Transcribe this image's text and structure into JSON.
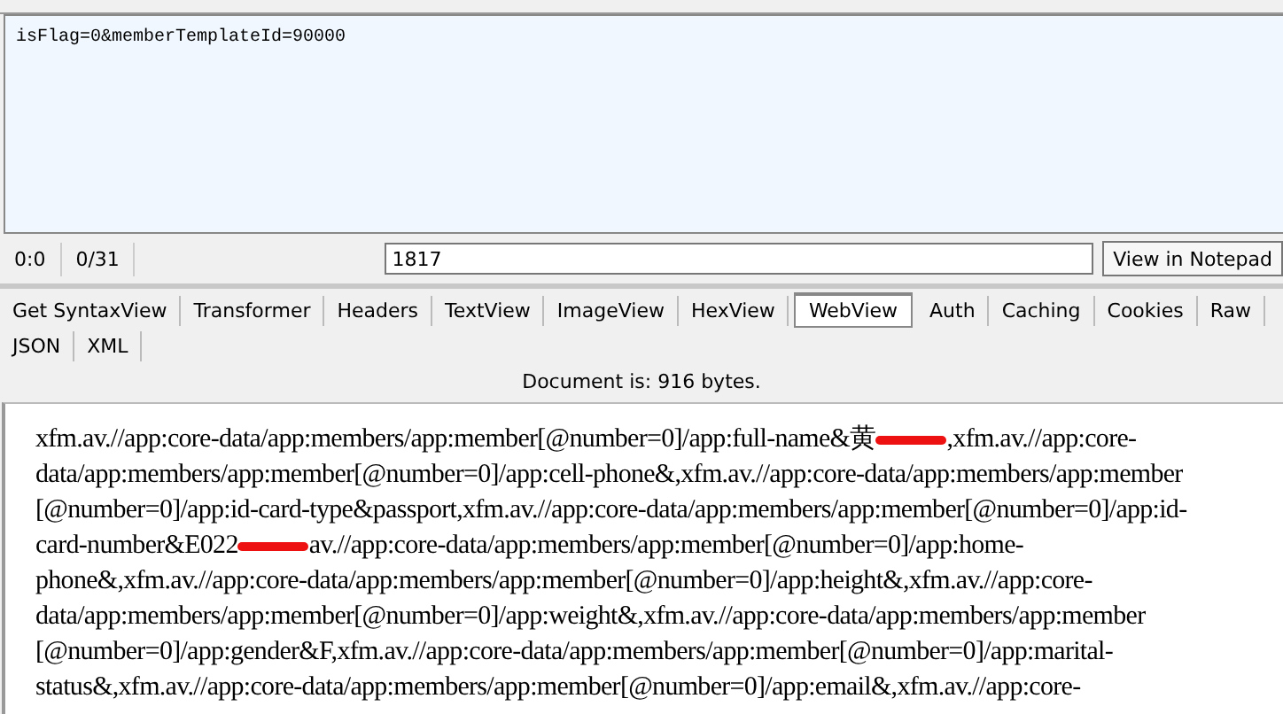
{
  "request_body": {
    "text": "isFlag=0&memberTemplateId=90000"
  },
  "status_bar": {
    "position": "0:0",
    "match": "0/31",
    "field_value": "1817",
    "button": "View in Notepad"
  },
  "tabs": [
    [
      {
        "label": "Get SyntaxView",
        "selected": false
      },
      {
        "label": "Transformer",
        "selected": false
      },
      {
        "label": "Headers",
        "selected": false
      },
      {
        "label": "TextView",
        "selected": false
      },
      {
        "label": "ImageView",
        "selected": false
      },
      {
        "label": "HexView",
        "selected": false
      },
      {
        "label": "WebView",
        "selected": true
      },
      {
        "label": "Auth",
        "selected": false
      },
      {
        "label": "Caching",
        "selected": false
      },
      {
        "label": "Cookies",
        "selected": false
      },
      {
        "label": "Raw",
        "selected": false
      }
    ],
    [
      {
        "label": "JSON",
        "selected": false
      },
      {
        "label": "XML",
        "selected": false
      }
    ]
  ],
  "document_info": "Document is: 916 bytes.",
  "web_view": {
    "lines": [
      [
        {
          "kind": "text",
          "text": "xfm.av.//app:core-data/app:members/app:member[@number=0]/app:full-name&黄"
        },
        {
          "kind": "redaction"
        },
        {
          "kind": "text",
          "text": ",xfm.av.//app:core-"
        }
      ],
      [
        {
          "kind": "text",
          "text": "data/app:members/app:member[@number=0]/app:cell-phone&,xfm.av.//app:core-data/app:members/app:member"
        }
      ],
      [
        {
          "kind": "text",
          "text": "[@number=0]/app:id-card-type&passport,xfm.av.//app:core-data/app:members/app:member[@number=0]/app:id-"
        }
      ],
      [
        {
          "kind": "text",
          "text": "card-number&E022"
        },
        {
          "kind": "redaction"
        },
        {
          "kind": "text",
          "text": "av.//app:core-data/app:members/app:member[@number=0]/app:home-"
        }
      ],
      [
        {
          "kind": "text",
          "text": "phone&,xfm.av.//app:core-data/app:members/app:member[@number=0]/app:height&,xfm.av.//app:core-"
        }
      ],
      [
        {
          "kind": "text",
          "text": "data/app:members/app:member[@number=0]/app:weight&,xfm.av.//app:core-data/app:members/app:member"
        }
      ],
      [
        {
          "kind": "text",
          "text": "[@number=0]/app:gender&F,xfm.av.//app:core-data/app:members/app:member[@number=0]/app:marital-"
        }
      ],
      [
        {
          "kind": "text",
          "text": "status&,xfm.av.//app:core-data/app:members/app:member[@number=0]/app:email&,xfm.av.//app:core-"
        }
      ]
    ]
  }
}
